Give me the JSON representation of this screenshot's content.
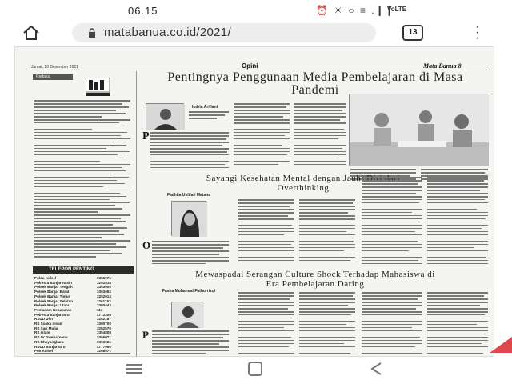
{
  "status": {
    "time": "06.15",
    "icons": "⏰ ☀ ○ ≡ .❙❙",
    "network": "VoLTE"
  },
  "browser": {
    "url": "matabanua.co.id/2021/",
    "tab_count": "13"
  },
  "newspaper": {
    "date": "Jumat, 10 Desember 2021",
    "section": "Opini",
    "brand": "Mata Banua  8",
    "redaksi_label": "Redaksi",
    "telepon_label": "TELEPON PENTING",
    "telepon": [
      {
        "name": "Polda Kalsel",
        "num": "3366071"
      },
      {
        "name": "Polresta Banjarmasin",
        "num": "3251414"
      },
      {
        "name": "Polsek Banjar Tengah",
        "num": "3353000"
      },
      {
        "name": "Polsek Banjar Barat",
        "num": "3353052"
      },
      {
        "name": "Polsek Banjar Timur",
        "num": "3252014"
      },
      {
        "name": "Polsek Banjar Selatan",
        "num": "3261153"
      },
      {
        "name": "Polsek Banjar Utara",
        "num": "3300443"
      },
      {
        "name": "Pemadam Kebakaran",
        "num": "113"
      },
      {
        "name": "Polresta Banjarbaru",
        "num": "4772200"
      },
      {
        "name": "RSUD Ulin",
        "num": "3252187"
      },
      {
        "name": "RS Suaka Insan",
        "num": "3300700"
      },
      {
        "name": "RS Sari Mulia",
        "num": "3252570"
      },
      {
        "name": "RS Islam",
        "num": "3354808"
      },
      {
        "name": "RS Dr. Soeharsono",
        "num": "3366071"
      },
      {
        "name": "RS Bhayangkara",
        "num": "3356021"
      },
      {
        "name": "RSUD Banjarbaru",
        "num": "4777060"
      },
      {
        "name": "PMI Kalsel",
        "num": "3268571"
      }
    ],
    "articles": [
      {
        "headline": "Pentingnya Penggunaan Media Pembelajaran di Masa Pandemi",
        "author": "Indria Arifiani",
        "dropcap": "P"
      },
      {
        "headline": "Sayangi Kesehatan Mental dengan Jauhi Diri dari Overthinking",
        "author": "Fadhila Uslifati Matana",
        "dropcap": "O"
      },
      {
        "headline": "Mewaspadai Serangan Culture Shock Terhadap Mahasiswa di Era Pembelajaran Daring",
        "author": "Fasha Muhamad Fathurrizqi",
        "dropcap": "P"
      }
    ]
  },
  "colors": {
    "accent_red": "#e0464e",
    "ink": "#222222",
    "paper": "#f4f4f0"
  }
}
